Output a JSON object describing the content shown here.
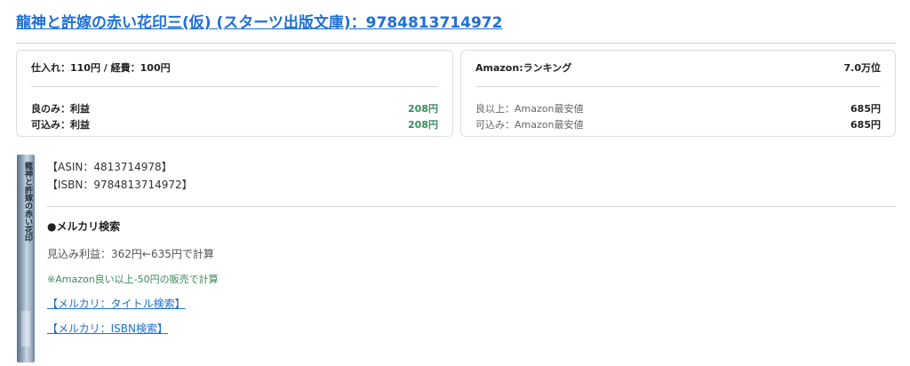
{
  "title": "龍神と許嫁の赤い花印三(仮) (スターツ出版文庫)：9784813714972",
  "cost_card": {
    "header": "仕入れ：110円 / 経費：100円",
    "rows": [
      {
        "label": "良のみ：利益",
        "value": "208円"
      },
      {
        "label": "可込み：利益",
        "value": "208円"
      }
    ]
  },
  "amazon_card": {
    "header_label": "Amazon:ランキング",
    "header_value": "7.0万位",
    "rows": [
      {
        "label": "良以上：Amazon最安値",
        "value": "685円"
      },
      {
        "label": "可込み：Amazon最安値",
        "value": "685円"
      }
    ]
  },
  "book_cover": {
    "spine_title": "龍神と許嫁の赤い花印"
  },
  "asin": "【ASIN：4813714978】",
  "isbn": "【ISBN：9784813714972】",
  "mercari": {
    "heading": "●メルカリ検索",
    "profit_text": "見込み利益：362円←635円で計算",
    "note": "※Amazon良い以上-50円の販売で計算",
    "title_search_link": "【メルカリ：タイトル検索】",
    "isbn_search_link": "【メルカリ：ISBN検索】"
  },
  "colors": {
    "link": "#1f6fd6",
    "profit_green": "#3a8a5a"
  }
}
